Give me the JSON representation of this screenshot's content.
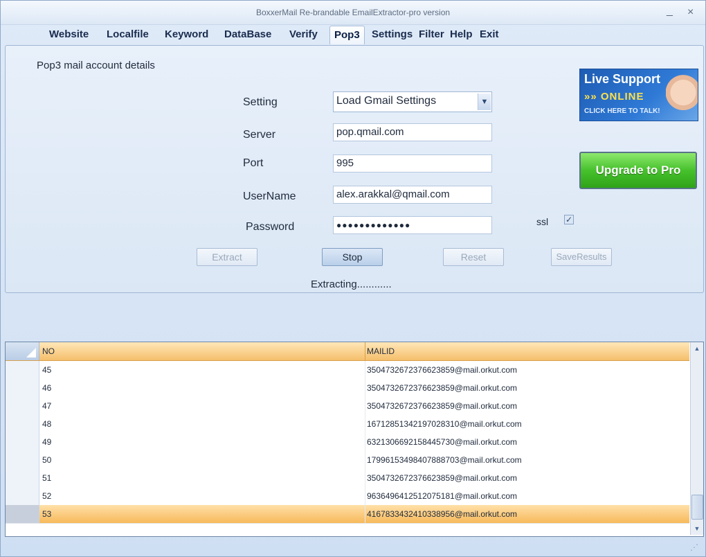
{
  "window": {
    "title": "BoxxerMail Re-brandable EmailExtractor-pro version",
    "minimize_glyph": "_",
    "close_glyph": "×"
  },
  "menu": {
    "items": [
      {
        "label": "Website"
      },
      {
        "label": "Localfile"
      },
      {
        "label": "Keyword"
      },
      {
        "label": "DataBase"
      },
      {
        "label": "Verify"
      },
      {
        "label": "Pop3"
      },
      {
        "label": "Settings"
      },
      {
        "label": "Filter"
      },
      {
        "label": "Help"
      },
      {
        "label": "Exit"
      }
    ],
    "active": "Pop3"
  },
  "pop3": {
    "section_title": "Pop3 mail account details",
    "setting_label": "Setting",
    "setting_value": "Load Gmail Settings",
    "server_label": "Server",
    "server_value": "pop.qmail.com",
    "port_label": "Port",
    "port_value": "995",
    "username_label": "UserName",
    "username_value": "alex.arakkal@qmail.com",
    "password_label": "Password",
    "password_value": "●●●●●●●●●●●●●",
    "ssl_label": "ssl",
    "ssl_checked": true,
    "buttons": {
      "extract": "Extract",
      "stop": "Stop",
      "reset": "Reset",
      "save": "SaveResults"
    },
    "status": "Extracting............"
  },
  "banner": {
    "live_title": "Live Support",
    "online": "»» ONLINE",
    "click": "CLICK HERE TO TALK!",
    "upgrade": "Upgrade to Pro"
  },
  "grid": {
    "columns": [
      "NO",
      "MAILID"
    ],
    "rows": [
      {
        "no": "45",
        "mail": "3504732672376623859@mail.orkut.com"
      },
      {
        "no": "46",
        "mail": "3504732672376623859@mail.orkut.com"
      },
      {
        "no": "47",
        "mail": "3504732672376623859@mail.orkut.com"
      },
      {
        "no": "48",
        "mail": "16712851342197028310@mail.orkut.com"
      },
      {
        "no": "49",
        "mail": "6321306692158445730@mail.orkut.com"
      },
      {
        "no": "50",
        "mail": "17996153498407888703@mail.orkut.com"
      },
      {
        "no": "51",
        "mail": "3504732672376623859@mail.orkut.com"
      },
      {
        "no": "52",
        "mail": "9636496412512075181@mail.orkut.com"
      },
      {
        "no": "53",
        "mail": "4167833432410338956@mail.orkut.com"
      }
    ],
    "selected_row": "53"
  },
  "icons": {
    "dropdown": "chevron-down-icon",
    "scroll_up": "arrow-up-icon",
    "scroll_down": "arrow-down-icon",
    "grip": "resize-grip-icon"
  },
  "colors": {
    "header_orange": "#f5bf6c",
    "upgrade_green": "#46c12c",
    "live_blue": "#1e5cb3"
  }
}
